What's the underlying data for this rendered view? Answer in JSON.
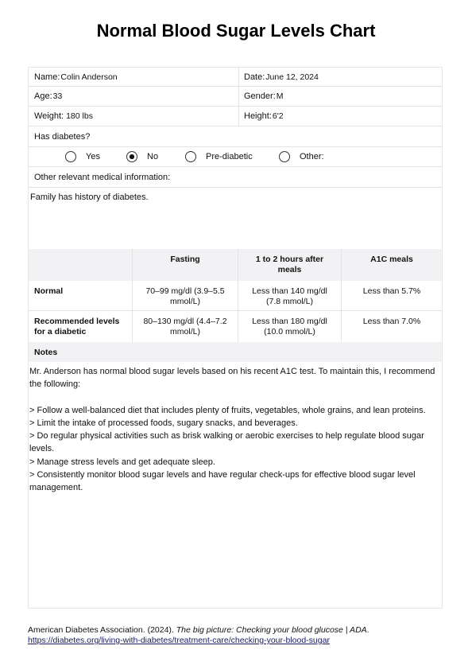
{
  "title": "Normal Blood Sugar Levels Chart",
  "patient": {
    "name_label": "Name:",
    "name": "Colin Anderson",
    "date_label": "Date:",
    "date": "June 12, 2024",
    "age_label": "Age:",
    "age": "33",
    "gender_label": "Gender:",
    "gender": "M",
    "weight_label": "Weight:",
    "weight": "180 lbs",
    "height_label": "Height:",
    "height": "6'2"
  },
  "diabetes": {
    "question": "Has diabetes?",
    "options": [
      {
        "label": "Yes",
        "selected": false
      },
      {
        "label": "No",
        "selected": true
      },
      {
        "label": "Pre-diabetic",
        "selected": false
      },
      {
        "label": "Other:",
        "selected": false
      }
    ]
  },
  "medical_info": {
    "label": "Other relevant medical information:",
    "value": "Family has history of diabetes."
  },
  "levels_table": {
    "headers": [
      "",
      "Fasting",
      "1 to 2 hours after meals",
      "A1C meals"
    ],
    "rows": [
      {
        "label": "Normal",
        "fasting": "70–99 mg/dl (3.9–5.5 mmol/L)",
        "after_meals": "Less than 140 mg/dl (7.8 mmol/L)",
        "a1c": "Less than 5.7%"
      },
      {
        "label": "Recommended levels for a diabetic",
        "fasting": "80–130 mg/dl (4.4–7.2 mmol/L)",
        "after_meals": "Less than 180 mg/dl (10.0 mmol/L)",
        "a1c": "Less than 7.0%"
      }
    ]
  },
  "notes": {
    "label": "Notes",
    "intro": "Mr. Anderson has normal blood sugar levels based on his recent A1C test. To maintain this, I recommend the following:",
    "items": [
      "> Follow a well-balanced diet that includes plenty of fruits, vegetables, whole grains, and lean proteins.",
      "> Limit the intake of processed foods, sugary snacks, and beverages.",
      "> Do regular physical activities such as brisk walking or aerobic exercises to help regulate blood sugar levels.",
      "> Manage stress levels and get adequate sleep.",
      "> Consistently monitor blood sugar levels and have regular check-ups for effective blood sugar level management."
    ]
  },
  "citation": {
    "prefix": "American Diabetes Association. (2024). ",
    "title": "The big picture: Checking your blood glucose | ADA",
    "suffix": ".",
    "url": "https://diabetes.org/living-with-diabetes/treatment-care/checking-your-blood-sugar"
  }
}
